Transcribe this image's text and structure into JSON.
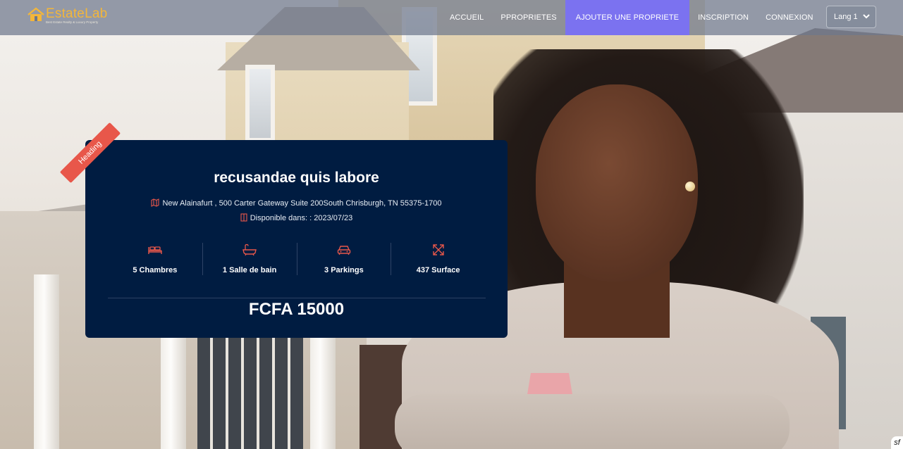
{
  "brand": {
    "name_part1": "Estate",
    "name_part2": "Lab",
    "tagline": "Best Estate Realty & Luxury Property"
  },
  "nav": {
    "items": [
      {
        "label": "ACCUEIL"
      },
      {
        "label": "PPROPRIETES"
      },
      {
        "label": "AJOUTER UNE PROPRIETE"
      },
      {
        "label": "INSCRIPTION"
      },
      {
        "label": "CONNEXION"
      }
    ],
    "active_index": 2,
    "lang_label": "Lang 1"
  },
  "property": {
    "ribbon": "Heading",
    "title": "recusandae quis labore",
    "address": "New Alainafurt , 500 Carter Gateway Suite 200South Chrisburgh, TN 55375-1700",
    "availability": "Disponible dans: : 2023/07/23",
    "stats": [
      {
        "icon": "bed-icon",
        "label": "5 Chambres"
      },
      {
        "icon": "bathtub-icon",
        "label": "1 Salle de bain"
      },
      {
        "icon": "car-icon",
        "label": "3 Parkings"
      },
      {
        "icon": "expand-icon",
        "label": "437 Surface"
      }
    ],
    "price": "FCFA 15000"
  },
  "colors": {
    "accent": "#7b72f0",
    "card_bg": "#001c41",
    "icon_red": "#e8574a",
    "logo_gold": "#f3b63a"
  },
  "badge": "sf"
}
